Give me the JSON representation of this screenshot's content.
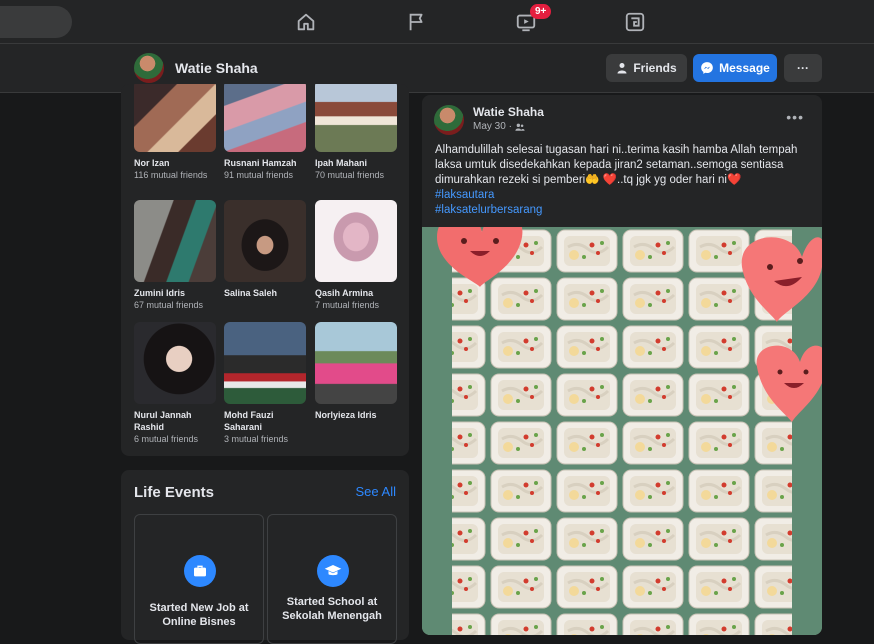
{
  "nav": {
    "items": [
      {
        "name": "home-icon"
      },
      {
        "name": "flag-icon"
      },
      {
        "name": "watch-icon",
        "badge": "9+"
      },
      {
        "name": "gaming-icon"
      }
    ]
  },
  "profile_bar": {
    "name": "Watie Shaha",
    "friends_label": "Friends",
    "message_label": "Message",
    "more_label": "···"
  },
  "friends": [
    {
      "name": "Nor Izan",
      "mutual": "116 mutual friends"
    },
    {
      "name": "Rusnani Hamzah",
      "mutual": "91 mutual friends"
    },
    {
      "name": "Ipah Mahani",
      "mutual": "70 mutual friends"
    },
    {
      "name": "Zumini Idris",
      "mutual": "67 mutual friends"
    },
    {
      "name": "Salina Saleh",
      "mutual": ""
    },
    {
      "name": "Qasih Armina",
      "mutual": "7 mutual friends"
    },
    {
      "name": "Nurul Jannah Rashid",
      "mutual": "6 mutual friends"
    },
    {
      "name": "Mohd Fauzi Saharani",
      "mutual": "3 mutual friends"
    },
    {
      "name": "Norlyieza Idris",
      "mutual": ""
    }
  ],
  "life_events": {
    "title": "Life Events",
    "see_all": "See All",
    "events": [
      {
        "label": "Started New Job at Online Bisnes"
      },
      {
        "label": "Started School at Sekolah Menengah"
      }
    ]
  },
  "post": {
    "author": "Watie Shaha",
    "date": "May 30 ·",
    "text": "Alhamdulillah selesai tugasan hari ni..terima kasih hamba Allah tempah laksa umtuk disedekahkan kepada jiran2 setaman..semoga sentiasa dimurahkan rezeki si pemberi🤲 ❤️..tq jgk yg oder hari ni❤️",
    "hashtags": [
      "#laksautara",
      "#laksatelurbersarang"
    ],
    "more_label": "•••"
  },
  "colors": {
    "background": "#18191a",
    "card": "#242526",
    "accent": "#2374e1",
    "link": "#2d88ff",
    "badge": "#e41e3f"
  }
}
